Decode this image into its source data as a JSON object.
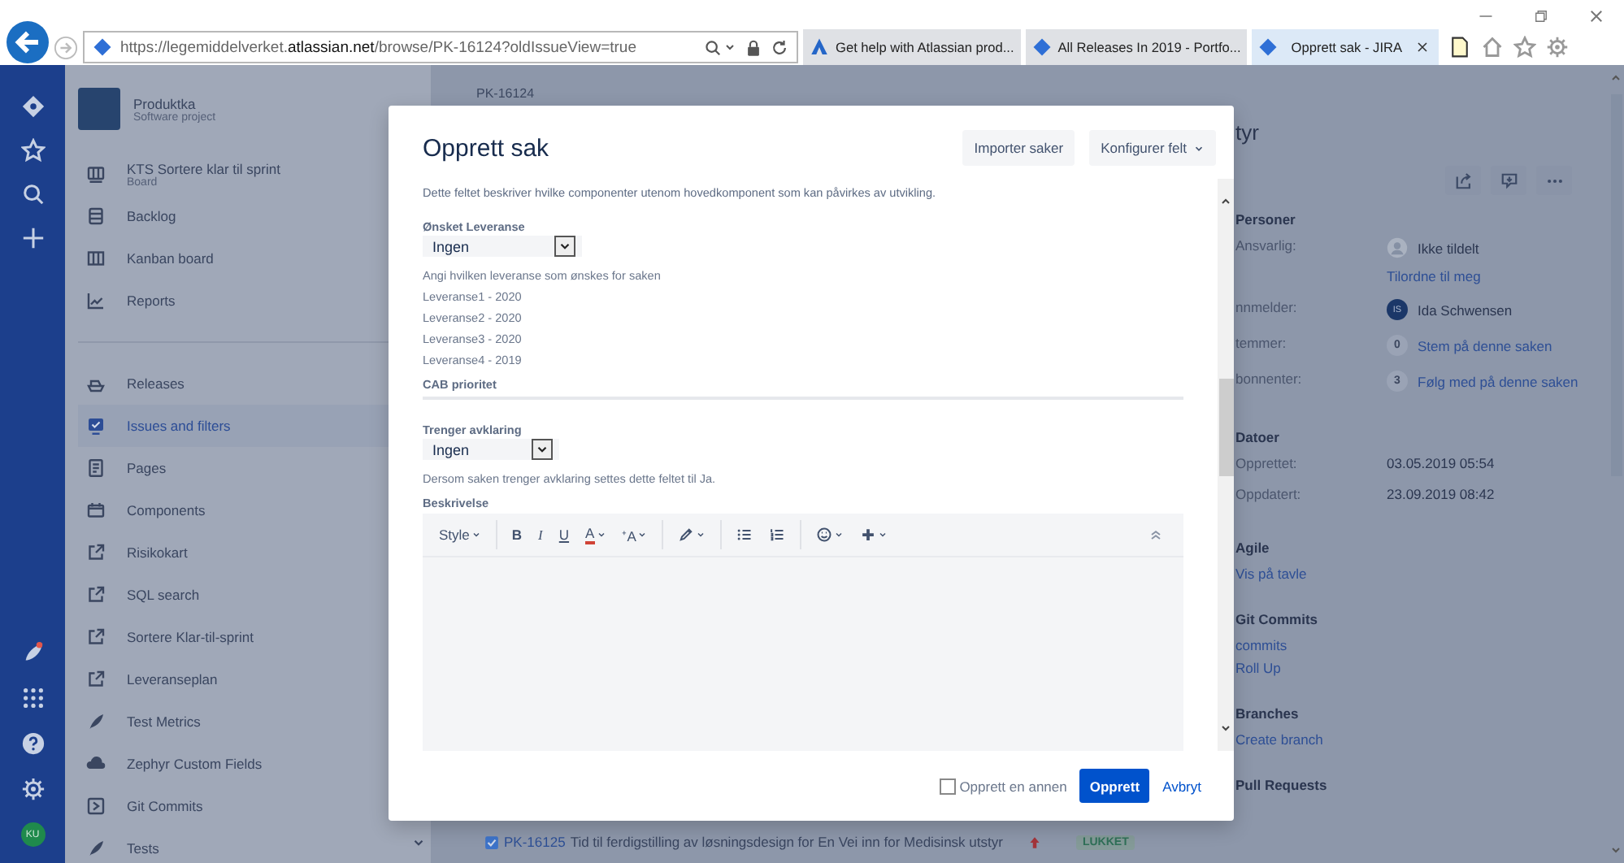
{
  "browser": {
    "address": "https://legemiddelverket.**atlassian.net**/browse/PK-16124?oldIssueView=true",
    "tabs": [
      {
        "title": "Get help with Atlassian prod...",
        "selected": false
      },
      {
        "title": "All Releases In 2019 - Portfo...",
        "selected": false
      },
      {
        "title": "Opprett sak - JIRA",
        "selected": true
      }
    ]
  },
  "global_nav": {
    "top": [
      {
        "kind": "logo"
      },
      {
        "kind": "star"
      },
      {
        "kind": "search"
      },
      {
        "kind": "plus"
      }
    ],
    "bottom": [
      {
        "kind": "rocket"
      },
      {
        "kind": "apps"
      },
      {
        "kind": "help"
      },
      {
        "kind": "settings"
      }
    ],
    "avatar": "KU"
  },
  "sidebar": {
    "project": {
      "name": "Produktka",
      "type": "Software project"
    },
    "board": {
      "label": "KTS Sortere klar til sprint",
      "sublabel": "Board"
    },
    "top_items": [
      {
        "label": "Backlog",
        "selected": false
      },
      {
        "label": "Kanban board",
        "selected": false
      },
      {
        "label": "Reports",
        "selected": false
      }
    ],
    "items": [
      {
        "label": "Releases",
        "selected": false
      },
      {
        "label": "Issues and filters",
        "selected": true
      },
      {
        "label": "Pages",
        "selected": false
      },
      {
        "label": "Components",
        "selected": false
      },
      {
        "label": "Risikokart",
        "selected": false
      },
      {
        "label": "SQL search",
        "selected": false
      },
      {
        "label": "Sortere Klar-til-sprint",
        "selected": false
      },
      {
        "label": "Leveranseplan",
        "selected": false
      },
      {
        "label": "Test Metrics",
        "selected": false
      },
      {
        "label": "Zephyr Custom Fields",
        "selected": false
      },
      {
        "label": "Git Commits",
        "selected": false
      },
      {
        "label": "Tests",
        "selected": false
      }
    ]
  },
  "issue": {
    "key": "PK-16124",
    "title_fragment": "tyr",
    "sections": [
      {
        "heading": "Personer",
        "rows": [
          {
            "kind": "unassigned",
            "label": "Ansvarlig:",
            "value": "Ikke tildelt",
            "link": "Tilordne til meg"
          },
          {
            "kind": "user",
            "label": "nnmelder:",
            "initials": "IS",
            "value": "Ida Schwensen"
          },
          {
            "kind": "count",
            "label": "temmer:",
            "count": "0",
            "link": "Stem på denne saken"
          },
          {
            "kind": "count",
            "label": "bonnenter:",
            "count": "3",
            "link": "Følg med på denne saken"
          }
        ]
      },
      {
        "heading": "Datoer",
        "rows": [
          {
            "kind": "text",
            "label": "Opprettet:",
            "value": "03.05.2019 05:54"
          },
          {
            "kind": "text",
            "label": "Oppdatert:",
            "value": "23.09.2019 08:42"
          }
        ]
      },
      {
        "heading": "Agile",
        "links": [
          "Vis på tavle"
        ]
      },
      {
        "heading": "Git Commits",
        "links": [
          "commits",
          "Roll Up"
        ]
      },
      {
        "heading": "Branches",
        "links": [
          "Create branch"
        ]
      },
      {
        "heading": "Pull Requests"
      }
    ],
    "linked": {
      "key": "PK-16125",
      "summary": "Tid til ferdigstilling av løsningsdesign for En Vei inn for Medisinsk utstyr",
      "status": "LUKKET"
    }
  },
  "dialog": {
    "title": "Opprett sak",
    "header_buttons": [
      {
        "label": "Importer saker",
        "dropdown": false
      },
      {
        "label": "Konfigurer felt",
        "dropdown": true
      }
    ],
    "fields": [
      {
        "kind": "note",
        "text": "Dette feltet beskriver hvilke componenter utenom hovedkomponent som kan påvirkes av utvikling."
      },
      {
        "kind": "select",
        "label": "Ønsket Leveranse",
        "value": "Ingen",
        "wide": true,
        "help": [
          "Angi hvilken leveranse som ønskes for saken",
          "Leveranse1 - 2020",
          "Leveranse2 - 2020",
          "Leveranse3 - 2020",
          "Leveranse4 - 2019"
        ]
      },
      {
        "kind": "text",
        "label": "CAB prioritet"
      },
      {
        "kind": "select",
        "label": "Trenger avklaring",
        "value": "Ingen",
        "wide": false,
        "help": [
          "Dersom saken trenger avklaring settes dette feltet til Ja."
        ]
      },
      {
        "kind": "editor",
        "label": "Beskrivelse",
        "toolbar": [
          {
            "kind": "text",
            "label": "Style",
            "caret": true
          },
          {
            "kind": "sep"
          },
          {
            "kind": "bold",
            "label": "B",
            "caret": false
          },
          {
            "kind": "italic",
            "label": "I",
            "caret": false
          },
          {
            "kind": "underline",
            "label": "U",
            "caret": false
          },
          {
            "kind": "color",
            "label": "A",
            "caret": true
          },
          {
            "kind": "text",
            "label": "⁺A",
            "caret": true
          },
          {
            "kind": "sep"
          },
          {
            "kind": "link",
            "caret": true
          },
          {
            "kind": "sep"
          },
          {
            "kind": "bullets",
            "caret": false
          },
          {
            "kind": "numbers",
            "caret": false
          },
          {
            "kind": "sep"
          },
          {
            "kind": "emoji",
            "caret": true
          },
          {
            "kind": "insert",
            "caret": true
          }
        ]
      }
    ],
    "footer": {
      "another": {
        "label": "Opprett en annen",
        "checked": false
      },
      "submit": "Opprett",
      "cancel": "Avbryt"
    }
  }
}
